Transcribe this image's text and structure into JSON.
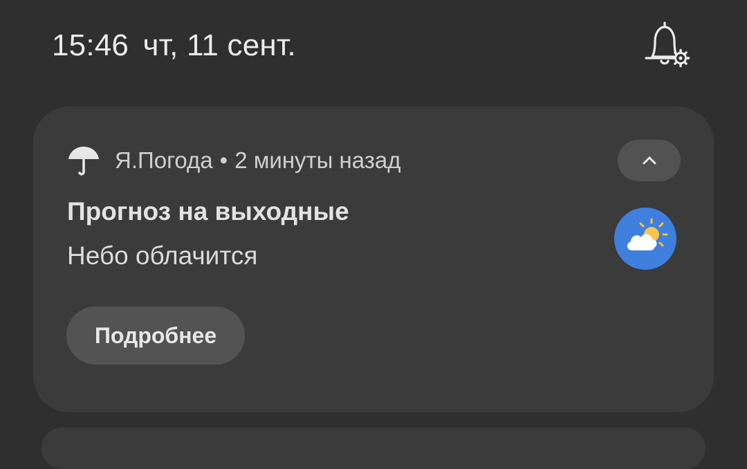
{
  "status_bar": {
    "time": "15:46",
    "date": "чт, 11 сент."
  },
  "header_icons": {
    "notification_settings_icon": "bell-gear-icon"
  },
  "notification": {
    "app_icon": "umbrella-icon",
    "app_name": "Я.Погода",
    "separator": "•",
    "time_ago": "2 минуты назад",
    "collapse_icon": "chevron-up-icon",
    "title": "Прогноз на выходные",
    "text": "Небо облачится",
    "large_icon": "partly-cloudy-weather-icon",
    "large_icon_bg": "#3f7fdd",
    "action_label": "Подробнее"
  },
  "colors": {
    "background": "#2f2f2f",
    "card": "#3b3b3b",
    "button": "#535353"
  }
}
